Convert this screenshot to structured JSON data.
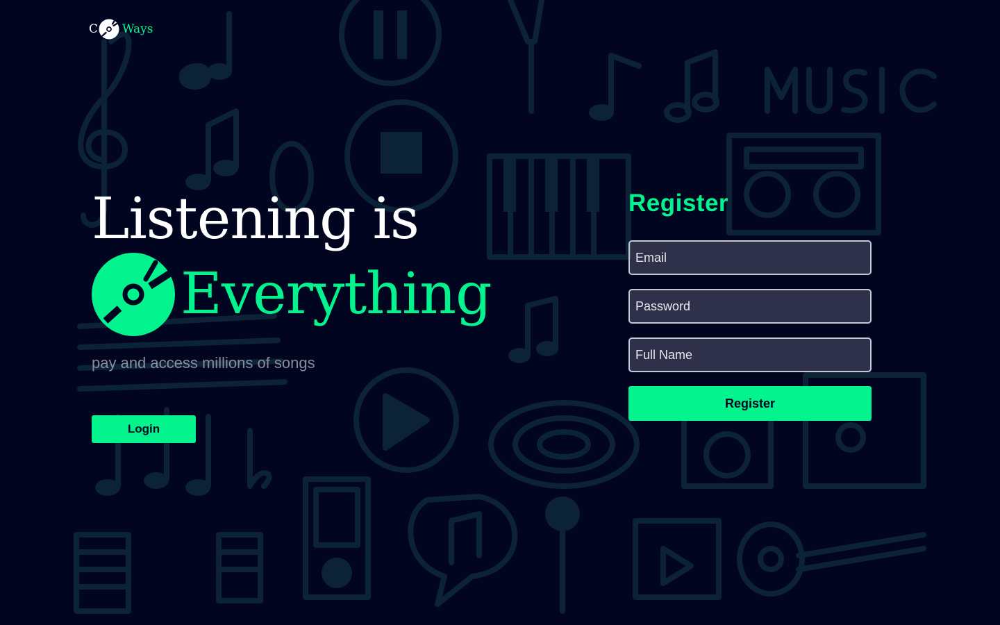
{
  "brand": {
    "logo_prefix": "C",
    "logo_suffix": "Ways",
    "disc_icon": "vinyl-disc-icon"
  },
  "hero": {
    "line1": "Listening is",
    "line2": "Everything",
    "tagline": "pay and access millions of songs"
  },
  "login": {
    "label": "Login"
  },
  "register": {
    "title": "Register",
    "email_placeholder": "Email",
    "password_placeholder": "Password",
    "fullname_placeholder": "Full Name",
    "button_label": "Register"
  },
  "colors": {
    "background": "#020520",
    "accent": "#03f38f",
    "doodle": "#0c2236",
    "text": "#ffffff",
    "muted": "#8a8c9c"
  }
}
